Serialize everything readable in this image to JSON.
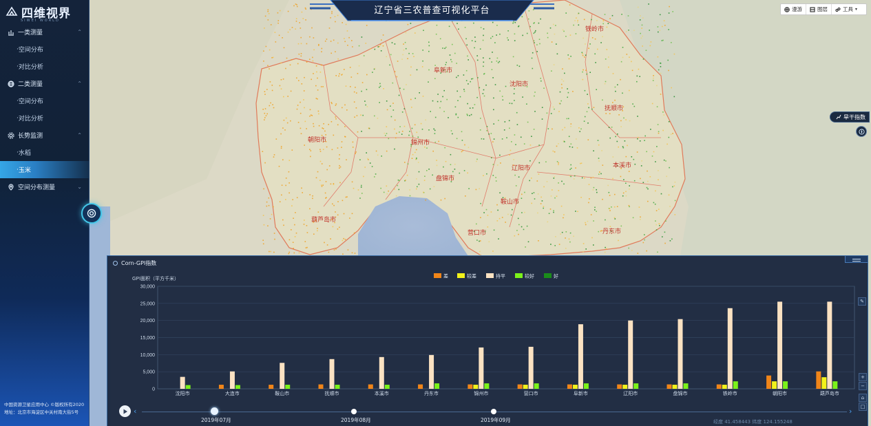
{
  "header": {
    "title": "辽宁省三农普查可视化平台"
  },
  "brand": {
    "name": "四维视界",
    "subtitle": "SIWEI WORLD"
  },
  "toolbar": {
    "items": [
      {
        "label": "漫游",
        "icon": "globe-icon"
      },
      {
        "label": "图层",
        "icon": "layers-icon"
      },
      {
        "label": "工具",
        "icon": "tools-icon"
      }
    ]
  },
  "sidebar": {
    "groups": [
      {
        "label": "一类测量",
        "icon": "bar-chart-icon",
        "expanded": true,
        "items": [
          "空间分布",
          "对比分析"
        ]
      },
      {
        "label": "二类测量",
        "icon": "globe-icon",
        "expanded": true,
        "items": [
          "空间分布",
          "对比分析"
        ]
      },
      {
        "label": "长势监测",
        "icon": "gear-icon",
        "expanded": true,
        "items": [
          "水稻",
          "玉米"
        ],
        "active_item": "玉米"
      },
      {
        "label": "空间分布测量",
        "icon": "location-icon",
        "expanded": false,
        "items": []
      }
    ],
    "footer_line1": "中国资源卫星应用中心 ©版权所有2020",
    "footer_line2": "地址：北京市海淀区中关村南大街5号"
  },
  "map": {
    "city_labels": [
      "铁岭市",
      "阜新市",
      "沈阳市",
      "抚顺市",
      "朝阳市",
      "锦州市",
      "辽阳市",
      "本溪市",
      "盘锦市",
      "鞍山市",
      "葫芦岛市",
      "营口市",
      "丹东市"
    ]
  },
  "side_buttons": {
    "drought_index": "旱干指数"
  },
  "panel": {
    "title": "Corn-GPI指数",
    "timeline": {
      "labels": [
        "2019年07月",
        "2019年08月",
        "2019年09月"
      ],
      "current": "2019年07月"
    },
    "coord_readout": "经度 41.458443  纬度 124.155248"
  },
  "chart_data": {
    "type": "bar",
    "ylabel": "GPI面积（平方千米）",
    "ylim": [
      0,
      30000
    ],
    "yticks": [
      "0",
      "5,000",
      "10,000",
      "15,000",
      "20,000",
      "25,000",
      "30,000"
    ],
    "grid": true,
    "legend_position": "top-center",
    "categories": [
      "沈阳市",
      "大连市",
      "鞍山市",
      "抚顺市",
      "本溪市",
      "丹东市",
      "锦州市",
      "营口市",
      "阜新市",
      "辽阳市",
      "盘锦市",
      "铁岭市",
      "朝阳市",
      "葫芦岛市"
    ],
    "series": [
      {
        "name": "差",
        "color": "#f08519",
        "values": [
          0,
          1200,
          1200,
          1300,
          1300,
          1300,
          1300,
          1300,
          1300,
          1300,
          1300,
          1300,
          3900,
          5100
        ]
      },
      {
        "name": "较差",
        "color": "#f2f21a",
        "values": [
          0,
          0,
          0,
          0,
          0,
          0,
          1200,
          1200,
          1200,
          1200,
          1200,
          1200,
          2200,
          3400
        ]
      },
      {
        "name": "持平",
        "color": "#fbe2c2",
        "values": [
          3500,
          5100,
          7600,
          8700,
          9300,
          9900,
          12100,
          12300,
          18900,
          20000,
          20400,
          23600,
          25500,
          25500
        ]
      },
      {
        "name": "较好",
        "color": "#7bf21a",
        "values": [
          1100,
          1100,
          1200,
          1200,
          1200,
          1600,
          1600,
          1600,
          1600,
          1600,
          1600,
          2200,
          2200,
          2200
        ]
      },
      {
        "name": "好",
        "color": "#1a8c1a",
        "values": [
          0,
          0,
          0,
          0,
          0,
          0,
          0,
          0,
          0,
          0,
          0,
          0,
          0,
          0
        ]
      }
    ]
  }
}
